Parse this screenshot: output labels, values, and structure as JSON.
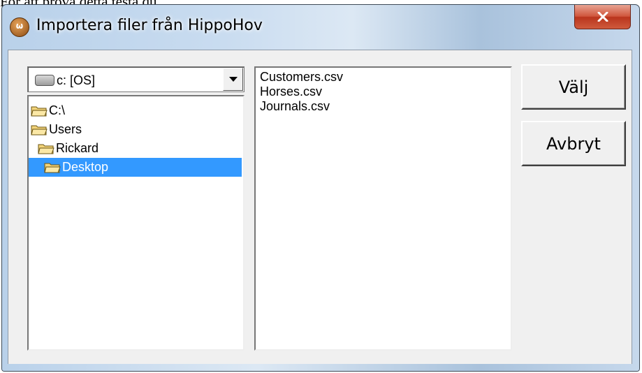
{
  "background": {
    "partial_text": "För att pröva detta testa du"
  },
  "window": {
    "title": "Importera filer från HippoHov",
    "icon": "hippohov-app-icon",
    "close_icon": "close-x-icon"
  },
  "drive": {
    "label": "c: [OS]",
    "icon": "drive-icon",
    "dropdown_icon": "chevron-down-icon"
  },
  "directories": [
    {
      "label": "C:\\",
      "selected": false
    },
    {
      "label": "Users",
      "selected": false
    },
    {
      "label": "Rickard",
      "selected": false
    },
    {
      "label": "Desktop",
      "selected": true
    }
  ],
  "files": [
    "Customers.csv",
    "Horses.csv",
    "Journals.csv"
  ],
  "buttons": {
    "select": "Välj",
    "cancel": "Avbryt"
  },
  "colors": {
    "selection": "#3399ff",
    "close_button": "#c8442a"
  }
}
